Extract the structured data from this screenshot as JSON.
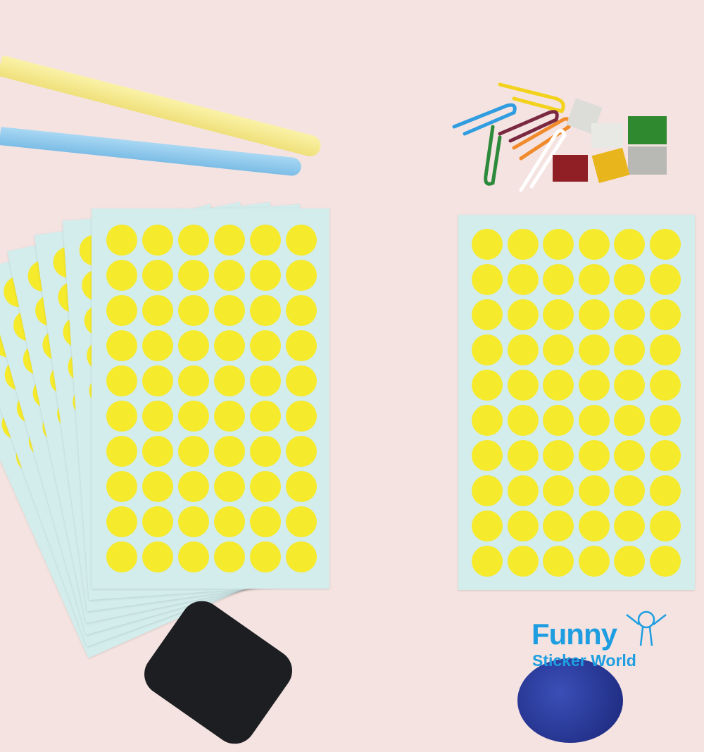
{
  "image": {
    "description_free": true,
    "colors": {
      "background": "#f4e3e1",
      "sheet": "#d3ecec",
      "dot": "#f6ea2c",
      "logo": "#1e9ee0"
    },
    "sticker_grid": {
      "columns": 6,
      "rows": 10
    }
  },
  "logo": {
    "line1": "Funny",
    "line2": "Sticker World"
  }
}
